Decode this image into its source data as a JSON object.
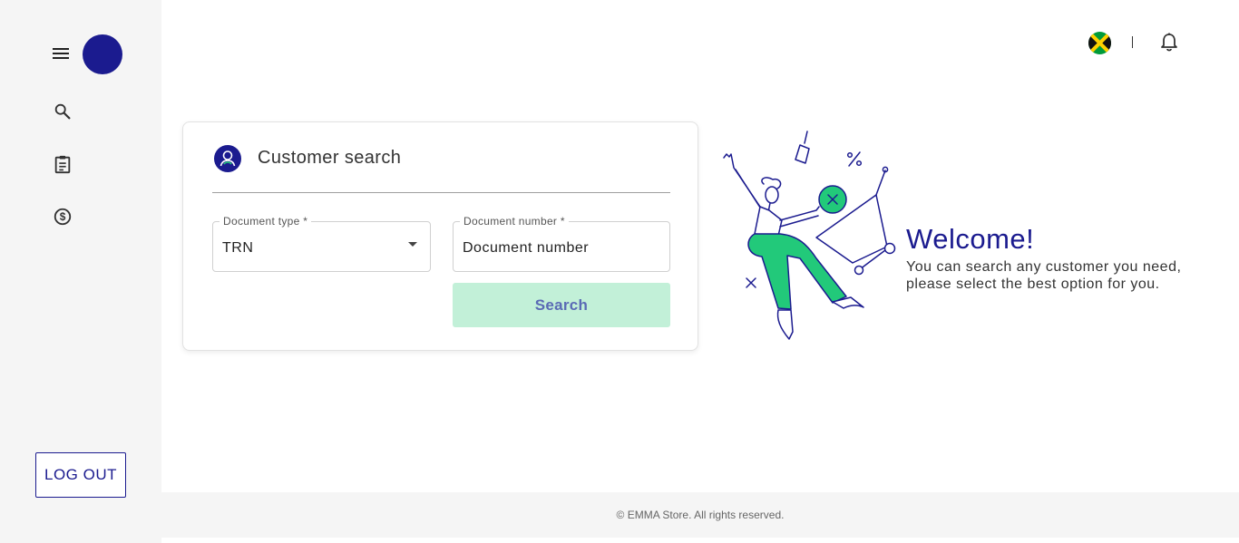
{
  "sidebar": {
    "menu_icon": "hamburger-icon",
    "nav_items": [
      {
        "icon": "search-icon"
      },
      {
        "icon": "clipboard-icon"
      },
      {
        "icon": "dollar-icon"
      }
    ],
    "logout_label": "LOG OUT"
  },
  "topbar": {
    "flag_icon": "jamaica-flag-icon",
    "separator": "|",
    "bell_icon": "bell-icon"
  },
  "customer_search": {
    "title": "Customer search",
    "document_type": {
      "label": "Document type *",
      "value": "TRN"
    },
    "document_number": {
      "label": "Document number *",
      "placeholder": "Document number"
    },
    "search_label": "Search"
  },
  "welcome": {
    "title": "Welcome!",
    "line1": "You can search any customer you need,",
    "line2": "please select the best option for you."
  },
  "footer": {
    "text": "© EMMA Store. All rights reserved."
  },
  "colors": {
    "brand": "#1b1b8f",
    "accent_green": "#22c97a",
    "button_disabled_bg": "#c2f0d8"
  }
}
